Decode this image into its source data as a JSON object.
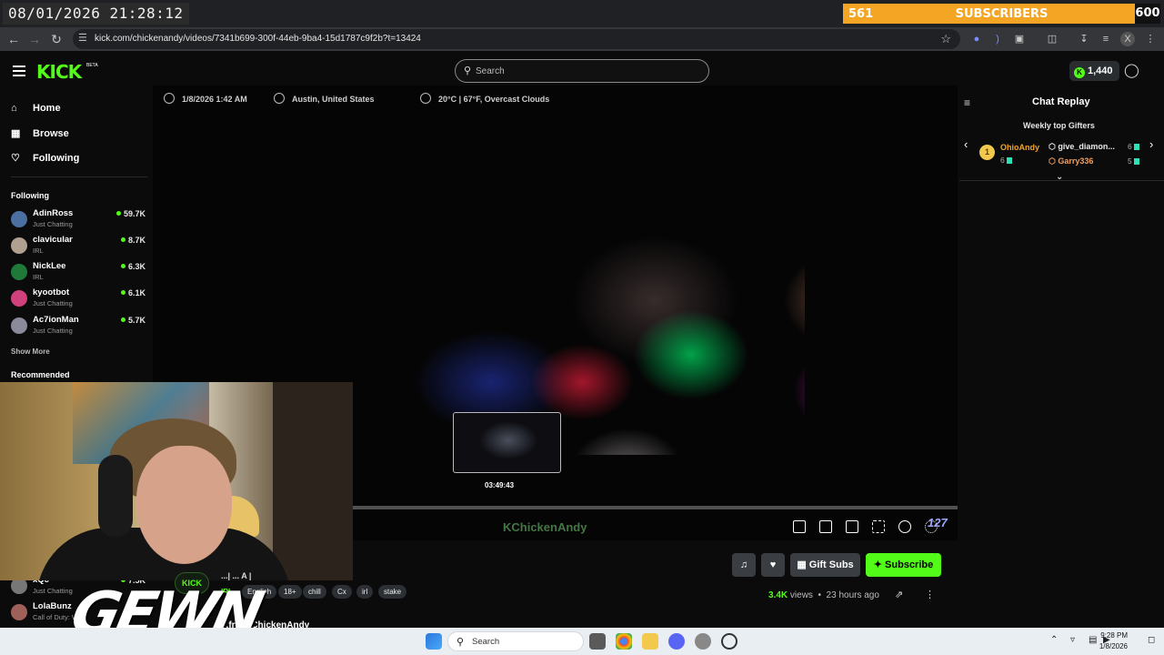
{
  "overlay": {
    "datetime": "08/01/2026 21:28:12",
    "sub_goal_current": "561",
    "sub_goal_label": "SUBSCRIBERS",
    "sub_goal_target": "600"
  },
  "browser": {
    "url": "kick.com/chickenandy/videos/7341b699-300f-44eb-9ba4-15d1787c9f2b?t=13424"
  },
  "header": {
    "logo": "KICK",
    "logo_badge": "BETA",
    "search_placeholder": "Search",
    "coins": "1,440"
  },
  "sidebar": {
    "nav": [
      {
        "label": "Home",
        "icon": "home-icon"
      },
      {
        "label": "Browse",
        "icon": "browse-icon"
      },
      {
        "label": "Following",
        "icon": "heart-icon"
      }
    ],
    "following_title": "Following",
    "channels": [
      {
        "name": "AdinRoss",
        "category": "Just Chatting",
        "viewers": "59.7K"
      },
      {
        "name": "clavicular",
        "category": "IRL",
        "viewers": "8.7K"
      },
      {
        "name": "NickLee",
        "category": "IRL",
        "viewers": "6.3K"
      },
      {
        "name": "kyootbot",
        "category": "Just Chatting",
        "viewers": "6.1K"
      },
      {
        "name": "Ac7ionMan",
        "category": "Just Chatting",
        "viewers": "5.7K"
      }
    ],
    "show_more": "Show More",
    "recommended_title": "Recommended",
    "recommended": [
      {
        "name": "xQc",
        "category": "Just Chatting",
        "viewers": "7.5K"
      },
      {
        "name": "LolaBunz",
        "category": "Call of Duty: W",
        "viewers": ""
      }
    ]
  },
  "video": {
    "meta_date": "1/8/2026 1:42 AM",
    "meta_location": "Austin, United States",
    "meta_weather": "20°C | 67°F, Overcast Clouds",
    "hover_time": "03:49:43",
    "progress": 0.183,
    "watermark": "KChickenAndy",
    "corner_number": "127"
  },
  "stream_info": {
    "channel_badge": "KICK",
    "title_fragment": "...| ... A |",
    "category": "IRL",
    "tags": [
      "English",
      "18+",
      "chill",
      "Cx",
      "irl",
      "stake"
    ],
    "views_count": "3.4K",
    "views_label": "views",
    "age": "23 hours ago",
    "from_label": "...from ChickenAndy",
    "buttons": {
      "gift_subs": "Gift Subs",
      "subscribe": "Subscribe"
    }
  },
  "streamer_overlay_text": "GEWN",
  "chat": {
    "title": "Chat Replay",
    "gifters_title": "Weekly top Gifters",
    "gifters": [
      {
        "rank": "1",
        "name": "OhioAndy",
        "count": "6",
        "color": "#f5a524"
      },
      {
        "rank": "",
        "name": "give_diamon...",
        "count": "6",
        "color": "#e8e8e8"
      },
      {
        "rank": "",
        "name": "Garry336",
        "count": "5",
        "color": "#f0a060"
      }
    ]
  },
  "taskbar": {
    "search": "Search",
    "time": "9:28 PM",
    "date": "1/8/2026"
  },
  "colors": {
    "accent": "#53fc18",
    "goal_bar": "#f5a524"
  }
}
